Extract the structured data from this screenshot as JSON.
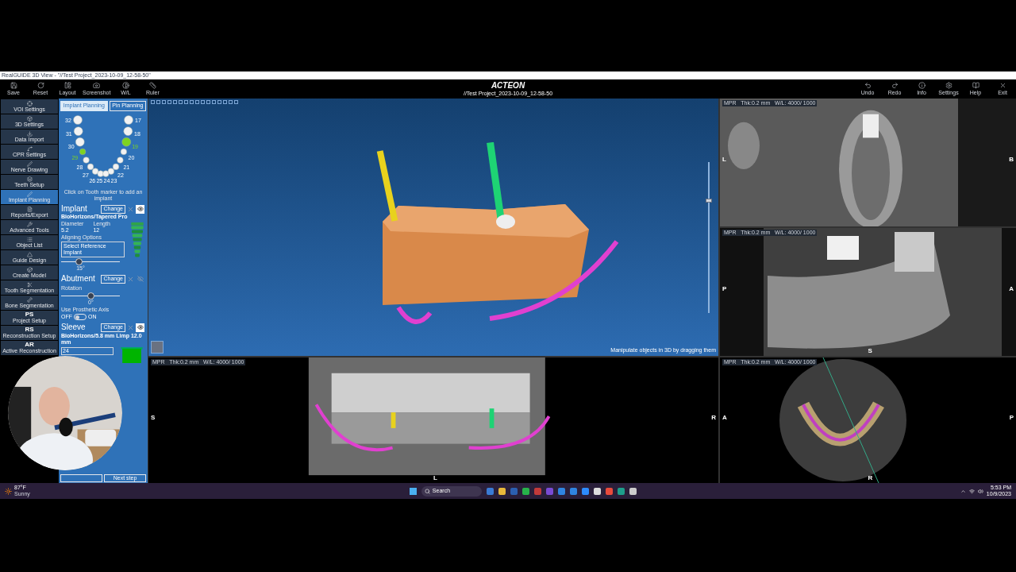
{
  "titlebar": {
    "title": "RealGUIDE 3D View - \"//Test Project_2023-10-09_12-58-50\""
  },
  "toolbar": {
    "left": [
      {
        "label": "Save"
      },
      {
        "label": "Reset"
      },
      {
        "label": "Layout"
      },
      {
        "label": "Screenshot"
      },
      {
        "label": "W/L"
      },
      {
        "label": "Ruler"
      }
    ],
    "brand": "ACTEON",
    "project": "//Test Project_2023-10-09_12-58-50",
    "right": [
      {
        "label": "Undo"
      },
      {
        "label": "Redo"
      },
      {
        "label": "Info"
      },
      {
        "label": "Settings"
      },
      {
        "label": "Help"
      },
      {
        "label": "Exit"
      }
    ]
  },
  "nav": [
    {
      "kind": "icon",
      "label": "VOI Settings",
      "selected": false
    },
    {
      "kind": "icon",
      "label": "3D Settings",
      "selected": false
    },
    {
      "kind": "icon",
      "label": "Data Import",
      "selected": false
    },
    {
      "kind": "icon",
      "label": "CPR Settings",
      "selected": false
    },
    {
      "kind": "icon",
      "label": "Nerve Drawing",
      "selected": false
    },
    {
      "kind": "icon",
      "label": "Teeth Setup",
      "selected": false
    },
    {
      "kind": "icon",
      "label": "Implant Planning",
      "selected": true
    },
    {
      "kind": "icon",
      "label": "Reports/Export",
      "selected": false
    },
    {
      "kind": "icon",
      "label": "Advanced Tools",
      "selected": false
    },
    {
      "kind": "icon",
      "label": "Object List",
      "selected": false
    },
    {
      "kind": "icon",
      "label": "Guide Design",
      "selected": false
    },
    {
      "kind": "icon",
      "label": "Create Model",
      "selected": false
    },
    {
      "kind": "icon",
      "label": "Tooth Segmentation",
      "selected": false
    },
    {
      "kind": "icon",
      "label": "Bone Segmentation",
      "selected": false
    },
    {
      "kind": "abbr",
      "abbr": "PS",
      "label": "Project Setup",
      "selected": false
    },
    {
      "kind": "abbr",
      "abbr": "RS",
      "label": "Reconstruction Setup",
      "selected": false
    },
    {
      "kind": "abbr",
      "abbr": "AR",
      "label": "Active Reconstruction",
      "selected": false
    }
  ],
  "panel": {
    "tabs": [
      {
        "label": "Implant Planning",
        "selected": true
      },
      {
        "label": "Pin Planning",
        "selected": false
      }
    ],
    "teeth": {
      "left": [
        {
          "number": "32",
          "selected": false
        },
        {
          "number": "31",
          "selected": false
        },
        {
          "number": "30",
          "selected": false
        },
        {
          "number": "29",
          "selected": true
        },
        {
          "number": "28",
          "selected": false
        }
      ],
      "front": [
        {
          "number": "27",
          "selected": false
        },
        {
          "number": "26",
          "selected": false
        },
        {
          "number": "25",
          "selected": false
        },
        {
          "number": "24",
          "selected": false
        },
        {
          "number": "23",
          "selected": false
        },
        {
          "number": "22",
          "selected": false
        }
      ],
      "right": [
        {
          "number": "17",
          "selected": false
        },
        {
          "number": "18",
          "selected": false
        },
        {
          "number": "19",
          "selected": true
        },
        {
          "number": "20",
          "selected": false
        },
        {
          "number": "21",
          "selected": false
        }
      ]
    },
    "teeth_hint": "Click on Tooth marker to add an implant",
    "implant": {
      "title": "Implant",
      "change": "Change",
      "eye_on": true,
      "model": "BioHorizons/Tapered Pro",
      "diameter_label": "Diameter",
      "diameter": "5.2",
      "length_label": "Length",
      "length": "12",
      "aligning_label": "Aligning Options",
      "reference_button": "Select Reference Implant",
      "angle": {
        "level": 0.3,
        "reading": "15°"
      }
    },
    "abutment": {
      "title": "Abutment",
      "change": "Change",
      "eye_on": false,
      "rotation_label": "Rotation",
      "rotation": {
        "level": 0.5,
        "reading": "0°"
      },
      "prosthetic_label": "Use Prosthetic Axis",
      "prosthetic_toggle": {
        "off": "OFF",
        "on": "ON",
        "checked": false
      }
    },
    "sleeve": {
      "title": "Sleeve",
      "change": "Change",
      "eye_on": true,
      "model": "BioHorizons/5.8 mm Limp 12.0 mm",
      "value": "24"
    },
    "next_button": "Next step"
  },
  "views": {
    "three_d": {
      "hint": "Manipulate objects in 3D by dragging them",
      "zoom": {
        "level": 0.75
      }
    },
    "slices": [
      {
        "kind": "cross",
        "header": "MPR   Thk:0.2 mm   W/L: 4000/ 1000",
        "labels": [
          "L",
          "B"
        ]
      },
      {
        "kind": "sagittal",
        "header": "MPR   Thk:0.2 mm   W/L: 4000/ 1000",
        "labels": [
          "P",
          "A",
          "S"
        ]
      },
      {
        "kind": "pano",
        "header": "MPR   Thk:0.2 mm   W/L: 4000/ 1000",
        "labels": [
          "S",
          "R",
          "L"
        ]
      },
      {
        "kind": "axial",
        "header": "MPR   Thk:0.2 mm   W/L: 4000/ 1000",
        "labels": [
          "A",
          "P",
          "R"
        ]
      }
    ]
  },
  "taskbar": {
    "temperature": "87°F",
    "weather": "Sunny",
    "search": "Search",
    "time": "5:53 PM",
    "date": "10/9/2023"
  }
}
